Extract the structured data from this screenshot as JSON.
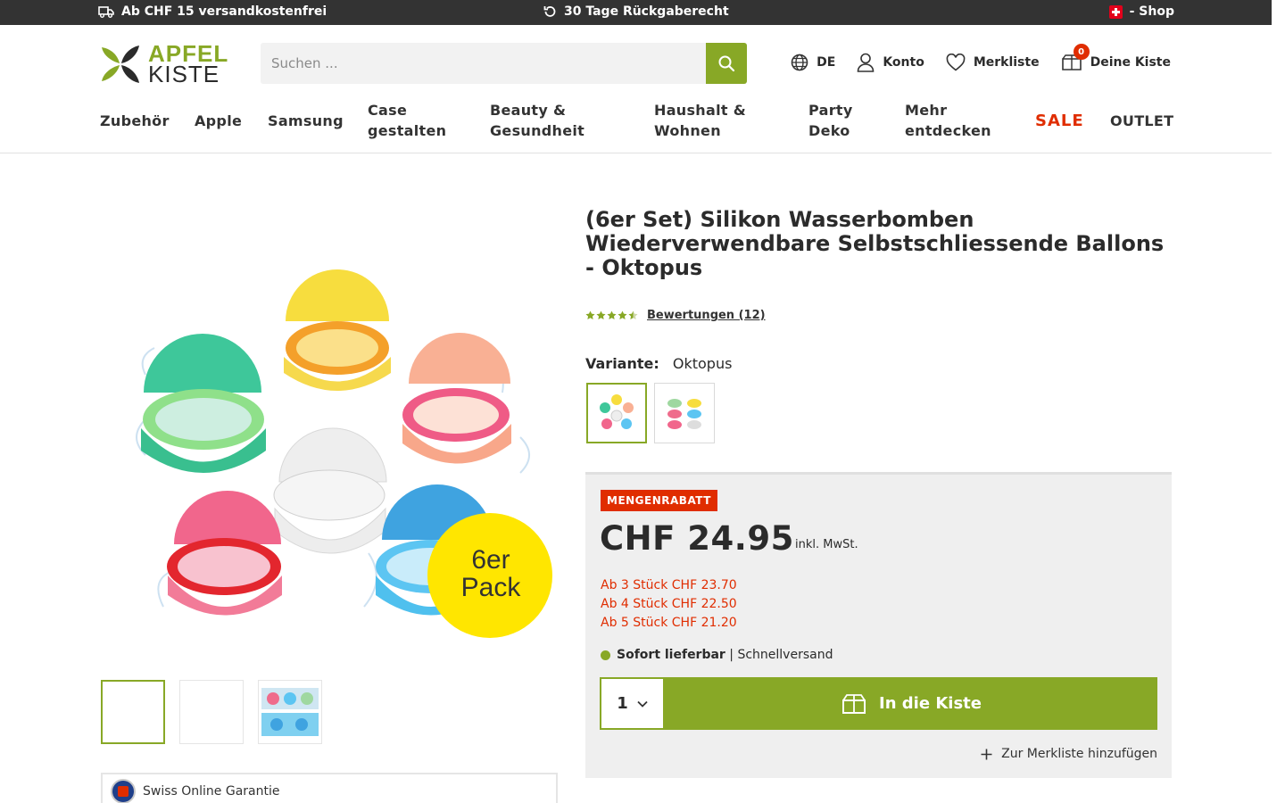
{
  "topbar": {
    "shipping": "Ab CHF 15 versandkostenfrei",
    "returns": "30 Tage Rückgaberecht",
    "shop": "- Shop"
  },
  "logo": {
    "line1": "APFEL",
    "line2": "KISTE"
  },
  "search": {
    "placeholder": "Suchen ..."
  },
  "header_actions": {
    "language": "DE",
    "account": "Konto",
    "wishlist": "Merkliste",
    "cart": "Deine Kiste",
    "cart_count": "0"
  },
  "nav": {
    "zubehoer": "Zubehör",
    "apple": "Apple",
    "samsung": "Samsung",
    "case_l1": "Case",
    "case_l2": "gestalten",
    "beauty_l1": "Beauty &",
    "beauty_l2": "Gesundheit",
    "haushalt_l1": "Haushalt &",
    "haushalt_l2": "Wohnen",
    "party_l1": "Party",
    "party_l2": "Deko",
    "mehr_l1": "Mehr",
    "mehr_l2": "entdecken",
    "sale": "SALE",
    "outlet": "OUTLET"
  },
  "product": {
    "title": "(6er Set) Silikon Wasserbomben Wiederverwendbare Selbstschliessende Ballons - Oktopus",
    "rating": 4.5,
    "reviews_link": "Bewertungen (12)",
    "image_badge_l1": "6er",
    "image_badge_l2": "Pack",
    "variant_label": "Variante:",
    "variant_value": "Oktopus"
  },
  "buybox": {
    "badge": "MENGENRABATT",
    "price": "CHF 24.95",
    "price_note": "inkl. MwSt.",
    "tiers": [
      "Ab 3 Stück CHF 23.70",
      "Ab 4 Stück CHF 22.50",
      "Ab 5 Stück CHF 21.20"
    ],
    "stock_bold": "Sofort lieferbar",
    "stock_rest": " | Schnellversand",
    "quantity": "1",
    "add_to_cart": "In die Kiste",
    "add_to_wishlist": "Zur Merkliste hinzufügen"
  },
  "guarantee": {
    "label": "Swiss Online Garantie"
  },
  "colors": {
    "brand_green": "#88a826",
    "sale_red": "#e02d00",
    "topbar": "#333333"
  }
}
